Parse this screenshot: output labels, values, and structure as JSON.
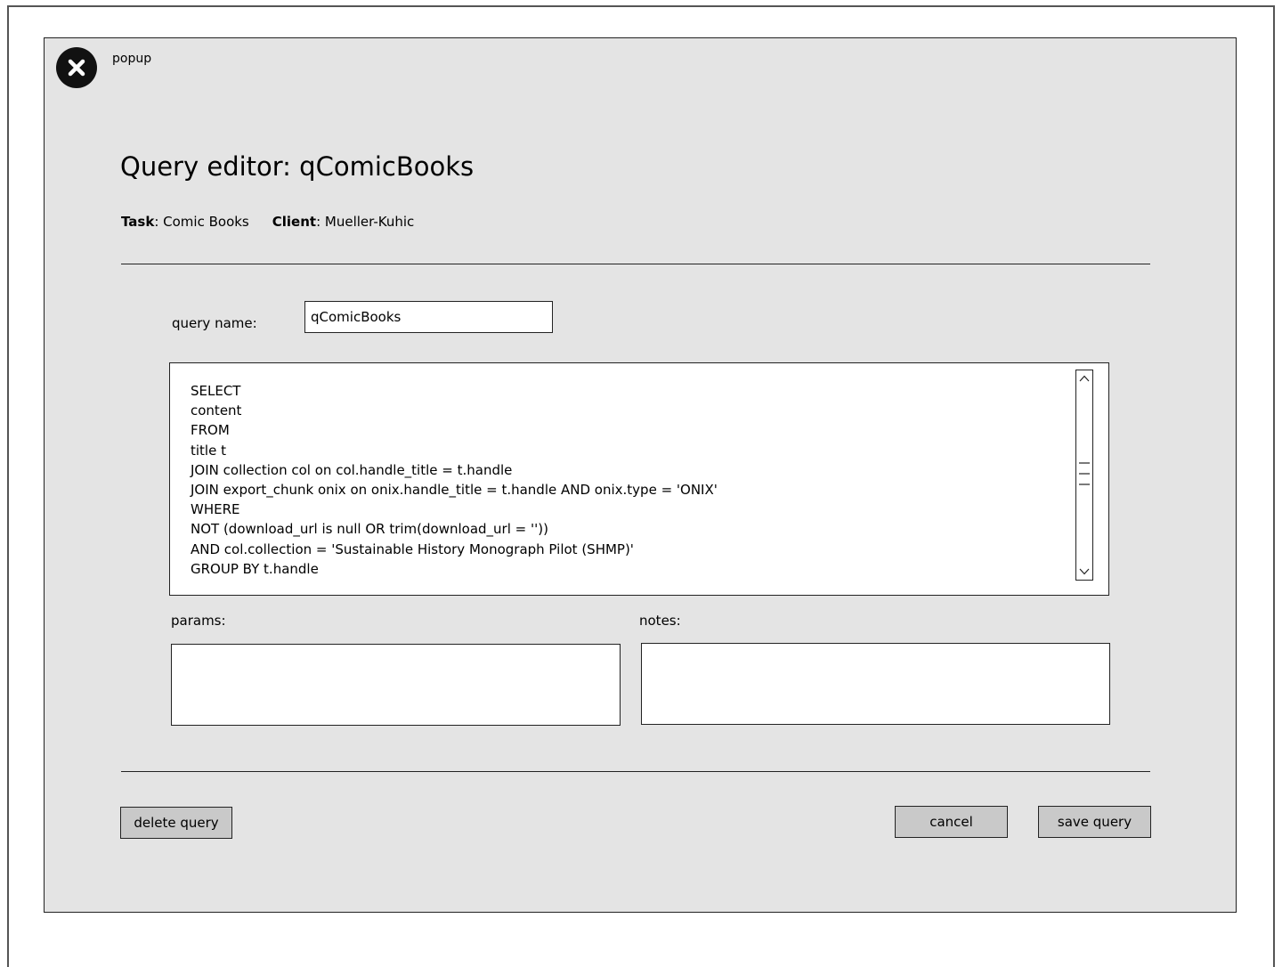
{
  "popup": {
    "label": "popup",
    "close_icon": "close-icon"
  },
  "header": {
    "title": "Query editor: qComicBooks",
    "task_label": "Task",
    "task_value": "Comic Books",
    "client_label": "Client",
    "client_value": "Mueller-Kuhic"
  },
  "form": {
    "query_name_label": "query name:",
    "query_name_value": "qComicBooks",
    "sql_lines": [
      "SELECT",
      "content",
      "FROM",
      "title t",
      "JOIN collection col on col.handle_title = t.handle",
      "JOIN export_chunk onix on onix.handle_title = t.handle AND onix.type = 'ONIX'",
      "WHERE",
      "NOT (download_url is null OR trim(download_url = ''))",
      "AND col.collection = 'Sustainable History Monograph Pilot (SHMP)'",
      "GROUP BY t.handle"
    ],
    "params_label": "params:",
    "params_value": "",
    "notes_label": "notes:",
    "notes_value": ""
  },
  "actions": {
    "delete_label": "delete query",
    "cancel_label": "cancel",
    "save_label": "save query"
  },
  "icons": {
    "close": "close-icon",
    "scroll_up": "chevron-up-icon",
    "scroll_down": "chevron-down-icon",
    "scroll_thumb": "scroll-thumb-grip-icon"
  }
}
